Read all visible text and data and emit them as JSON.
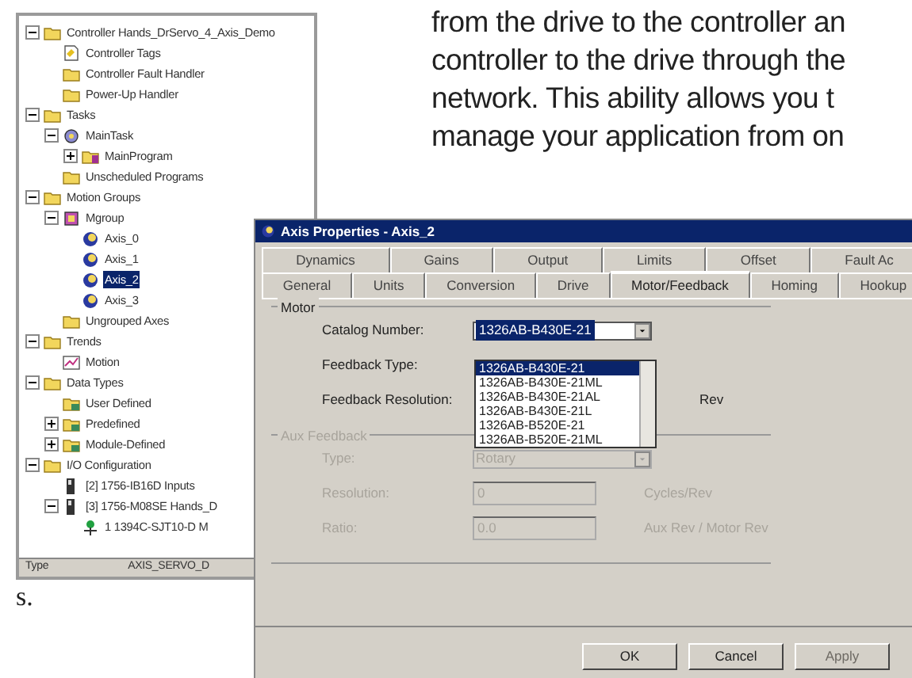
{
  "paragraph": {
    "lines": [
      "from the drive to the controller an",
      "controller to the drive through the",
      "network. This ability allows you t",
      "manage your application from on"
    ]
  },
  "fragment": "s.",
  "tree": {
    "items": [
      {
        "label": "Controller Hands_DrServo_4_Axis_Demo",
        "kind": "folder",
        "selected": false,
        "expanded": true,
        "children": [
          {
            "label": "Controller Tags",
            "kind": "page",
            "selected": false
          },
          {
            "label": "Controller Fault Handler",
            "kind": "folder",
            "selected": false
          },
          {
            "label": "Power-Up Handler",
            "kind": "folder",
            "selected": false
          }
        ]
      },
      {
        "label": "Tasks",
        "kind": "folder",
        "selected": false,
        "expanded": true,
        "children": [
          {
            "label": "MainTask",
            "kind": "task",
            "selected": false,
            "expanded": true,
            "children": [
              {
                "label": "MainProgram",
                "kind": "program",
                "selected": false,
                "expanded": false
              }
            ]
          },
          {
            "label": "Unscheduled Programs",
            "kind": "folder",
            "selected": false
          }
        ]
      },
      {
        "label": "Motion Groups",
        "kind": "folder",
        "selected": false,
        "expanded": true,
        "children": [
          {
            "label": "Mgroup",
            "kind": "group",
            "selected": false,
            "expanded": true,
            "children": [
              {
                "label": "Axis_0",
                "kind": "axis",
                "selected": false
              },
              {
                "label": "Axis_1",
                "kind": "axis",
                "selected": false
              },
              {
                "label": "Axis_2",
                "kind": "axis",
                "selected": true
              },
              {
                "label": "Axis_3",
                "kind": "axis",
                "selected": false
              }
            ]
          },
          {
            "label": "Ungrouped Axes",
            "kind": "folder",
            "selected": false
          }
        ]
      },
      {
        "label": "Trends",
        "kind": "folder",
        "selected": false,
        "expanded": true,
        "children": [
          {
            "label": "Motion",
            "kind": "trend",
            "selected": false
          }
        ]
      },
      {
        "label": "Data Types",
        "kind": "folder",
        "selected": false,
        "expanded": true,
        "children": [
          {
            "label": "User Defined",
            "kind": "datatype",
            "selected": false
          },
          {
            "label": "Predefined",
            "kind": "datatype",
            "selected": false,
            "expanded": false
          },
          {
            "label": "Module-Defined",
            "kind": "datatype",
            "selected": false,
            "expanded": false
          }
        ]
      },
      {
        "label": "I/O Configuration",
        "kind": "folder",
        "selected": false,
        "expanded": true,
        "children": [
          {
            "label": "[2] 1756-IB16D Inputs",
            "kind": "module",
            "selected": false
          },
          {
            "label": "[3] 1756-M08SE Hands_D",
            "kind": "module",
            "selected": false,
            "expanded": true,
            "children": [
              {
                "label": "1 1394C-SJT10-D M",
                "kind": "drive",
                "selected": false
              }
            ]
          }
        ]
      }
    ]
  },
  "status_bar": {
    "label": "Type",
    "value": "AXIS_SERVO_D"
  },
  "dialog": {
    "title": "Axis Properties - Axis_2",
    "tab_rows": [
      [
        {
          "label": "Dynamics",
          "selected": false
        },
        {
          "label": "Gains",
          "selected": false
        },
        {
          "label": "Output",
          "selected": false
        },
        {
          "label": "Limits",
          "selected": false
        },
        {
          "label": "Offset",
          "selected": false
        },
        {
          "label": "Fault Ac",
          "selected": false
        }
      ],
      [
        {
          "label": "General",
          "selected": false
        },
        {
          "label": "Units",
          "selected": false
        },
        {
          "label": "Conversion",
          "selected": false
        },
        {
          "label": "Drive",
          "selected": false
        },
        {
          "label": "Motor/Feedback",
          "selected": true
        },
        {
          "label": "Homing",
          "selected": false
        },
        {
          "label": "Hookup",
          "selected": false
        }
      ]
    ],
    "motor_group": {
      "title": "Motor",
      "disabled": false,
      "fields": [
        {
          "label": "Catalog Number:",
          "kind": "combo",
          "value": "1326AB-B430E-21"
        },
        {
          "label": "Feedback Type:",
          "kind": "blank"
        },
        {
          "label": "Feedback Resolution:",
          "kind": "blank",
          "unit": "Rev"
        }
      ]
    },
    "catalog_list": {
      "items": [
        {
          "text": "1326AB-B430E-21",
          "selected": true
        },
        {
          "text": "1326AB-B430E-21ML",
          "selected": false
        },
        {
          "text": "1326AB-B430E-21AL",
          "selected": false
        },
        {
          "text": "1326AB-B430E-21L",
          "selected": false
        },
        {
          "text": "1326AB-B520E-21",
          "selected": false
        },
        {
          "text": "1326AB-B520E-21ML",
          "selected": false
        }
      ]
    },
    "aux_group": {
      "title": "Aux Feedback",
      "disabled": true,
      "fields": [
        {
          "label": "Type:",
          "kind": "combo",
          "value": "Rotary"
        },
        {
          "label": "Resolution:",
          "kind": "text",
          "value": "0",
          "unit": "Cycles/Rev"
        },
        {
          "label": "Ratio:",
          "kind": "text",
          "value": "0.0",
          "unit": "Aux Rev / Motor Rev"
        }
      ]
    },
    "buttons": [
      {
        "label": "OK",
        "disabled": false
      },
      {
        "label": "Cancel",
        "disabled": false
      },
      {
        "label": "Apply",
        "disabled": true
      }
    ]
  }
}
